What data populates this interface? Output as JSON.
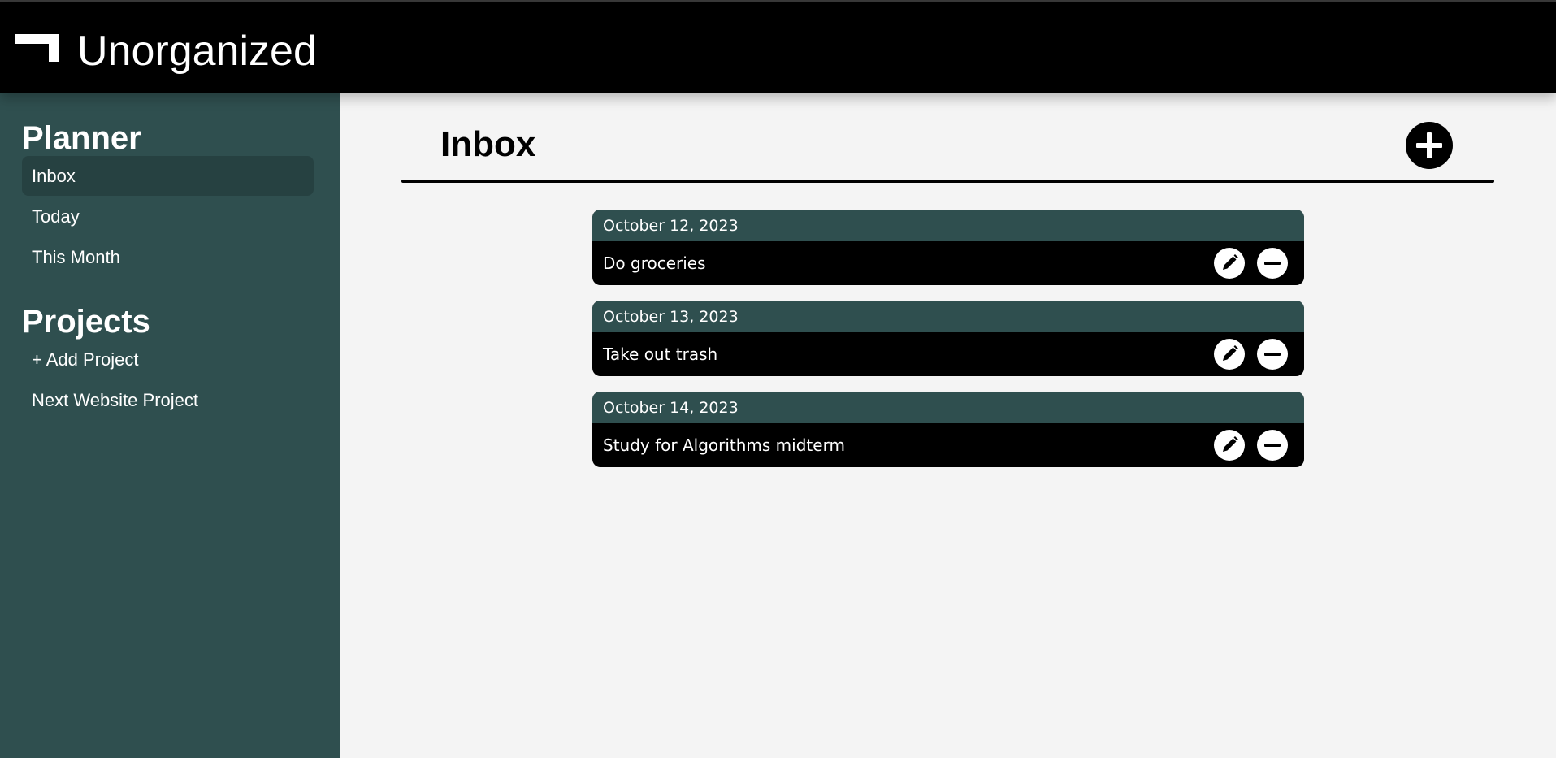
{
  "header": {
    "app_title": "Unorganized",
    "logo_icon": "corner-bracket-logo"
  },
  "sidebar": {
    "planner_title": "Planner",
    "planner_items": [
      {
        "label": "Inbox",
        "active": true
      },
      {
        "label": "Today",
        "active": false
      },
      {
        "label": "This Month",
        "active": false
      }
    ],
    "projects_title": "Projects",
    "project_items": [
      {
        "label": "+ Add Project"
      },
      {
        "label": "Next Website Project"
      }
    ]
  },
  "main": {
    "title": "Inbox",
    "add_icon": "plus-circle-icon",
    "tasks": [
      {
        "date": "October 12, 2023",
        "text": "Do groceries"
      },
      {
        "date": "October 13, 2023",
        "text": "Take out trash"
      },
      {
        "date": "October 14, 2023",
        "text": "Study for Algorithms midterm"
      }
    ],
    "edit_icon": "pencil-icon",
    "remove_icon": "minus-circle-icon"
  },
  "colors": {
    "sidebar_bg": "#2f4f4f",
    "sidebar_active": "#264141",
    "header_bg": "#000000",
    "main_bg": "#f4f4f4",
    "task_date_bg": "#2f4f4f",
    "task_body_bg": "#000000"
  }
}
